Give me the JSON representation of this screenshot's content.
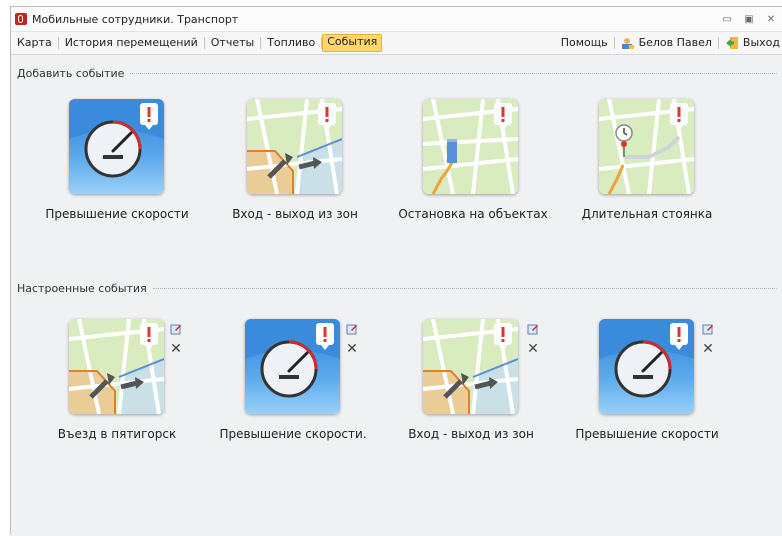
{
  "window": {
    "title": "Мобильные сотрудники. Транспорт",
    "controls": [
      "minimize-icon",
      "maximize-icon",
      "close-icon"
    ]
  },
  "menu": {
    "items": [
      {
        "label": "Карта"
      },
      {
        "label": "История перемещений"
      },
      {
        "label": "Отчеты"
      },
      {
        "label": "Топливо"
      },
      {
        "label": "События",
        "active": true
      }
    ],
    "help": "Помощь",
    "user": "Белов Павел",
    "exit": "Выход"
  },
  "sections": {
    "add_title": "Добавить событие",
    "configured_title": "Настроенные события"
  },
  "add_events": [
    {
      "label": "Превышение скорости",
      "icon": "speedometer-icon"
    },
    {
      "label": "Вход - выход из зон",
      "icon": "zone-map-icon"
    },
    {
      "label": "Остановка на объектах",
      "icon": "object-stop-map-icon"
    },
    {
      "label": "Длительная стоянка",
      "icon": "long-parking-map-icon"
    }
  ],
  "configured_events": [
    {
      "label": "Въезд в пятигорск",
      "icon": "zone-map-icon"
    },
    {
      "label": "Превышение скорости.",
      "icon": "speedometer-icon"
    },
    {
      "label": "Вход - выход из зон",
      "icon": "zone-map-icon"
    },
    {
      "label": "Превышение скорости",
      "icon": "speedometer-icon"
    }
  ],
  "colors": {
    "active_tab": "#ffd86c",
    "speed_tile_blue": "#4a98e0",
    "map_green": "#d8ecc0",
    "alert_red": "#e0352b"
  }
}
